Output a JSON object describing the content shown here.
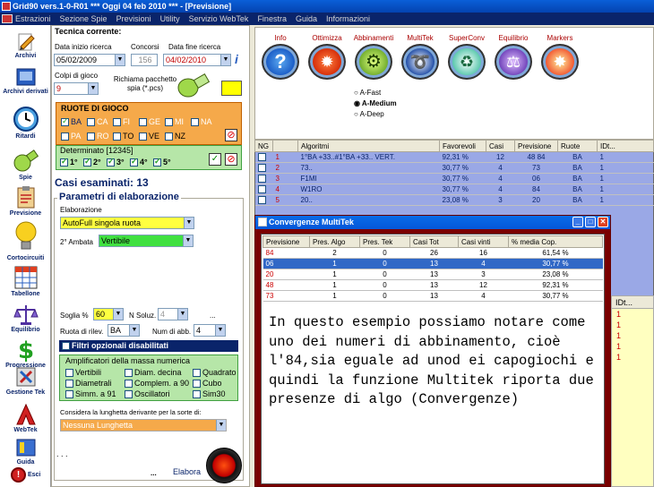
{
  "window": {
    "title": "Grid90 vers.1-0-R01   ***  Oggi 04 feb 2010   ***  - [Previsione]"
  },
  "menu": [
    "Estrazioni",
    "Sezione Spie",
    "Previsioni",
    "Utility",
    "Servizio WebTek",
    "Finestra",
    "Guida",
    "Informazioni"
  ],
  "sidebar": {
    "items": [
      "Archivi",
      "Archivi derivati",
      "Ritardi",
      "Spie",
      "Previsione",
      "Cortocircuiti",
      "Tabellone",
      "Equilibrio",
      "Progressione",
      "Gestione Tek",
      "WebTek",
      "Guida",
      "Esci"
    ]
  },
  "tecnica": {
    "header": "Tecnica corrente:",
    "data_inizio_label": "Data inizio ricerca",
    "data_inizio": "05/02/2009",
    "concorsi_label": "Concorsi",
    "concorsi": "156",
    "data_fine_label": "Data fine ricerca",
    "data_fine": "04/02/2010",
    "colpi_label": "Colpi di gioco",
    "colpi": "9",
    "pacchetto_label": "Richiama pacchetto spia (*.pcs)"
  },
  "ruote": {
    "header": "RUOTE DI GIOCO",
    "row1": [
      {
        "n": "BA",
        "on": true
      },
      {
        "n": "CA",
        "on": false
      },
      {
        "n": "FI",
        "on": false
      },
      {
        "n": "GE",
        "on": false
      },
      {
        "n": "MI",
        "on": false
      },
      {
        "n": "NA",
        "on": false
      }
    ],
    "row2": [
      {
        "n": "PA",
        "on": false
      },
      {
        "n": "RO",
        "on": false
      },
      {
        "n": "TO",
        "on": false
      },
      {
        "n": "VE",
        "on": false
      },
      {
        "n": "NZ",
        "on": false
      }
    ]
  },
  "determinato": {
    "label": "Determinato [12345]",
    "items": [
      {
        "n": "1°",
        "on": true
      },
      {
        "n": "2°",
        "on": true
      },
      {
        "n": "3°",
        "on": true
      },
      {
        "n": "4°",
        "on": true
      },
      {
        "n": "5°",
        "on": true
      }
    ]
  },
  "casi": "Casi esaminati: 13",
  "parametri": {
    "header": "Parametri di elaborazione",
    "elab_label": "Elaborazione",
    "elab_value": "AutoFull singola ruota",
    "ambata_label": "2° Ambata",
    "ambata_value": "Vertibile",
    "soglia_label": "Soglia %",
    "soglia_value": "60",
    "nsoluz_label": "N Soluz.",
    "nsoluz_value": "4",
    "ellipsis": "...",
    "ruota_label": "Ruota di rilev.",
    "ruota_value": "BA",
    "abb_label": "Num di abb.",
    "abb_value": "4",
    "filtri_label": "Filtri opzionali disabilitati",
    "ampl_label": "Amplificatori della massa numerica",
    "ampl": [
      [
        "Vertibili",
        "Diam. decina",
        "Quadrato"
      ],
      [
        "Diametrali",
        "Complem. a 90",
        "Cubo"
      ],
      [
        "Simm. a 91",
        "Oscillatori",
        "Sim30"
      ]
    ],
    "lunghetta_label": "Considera la lunghetta derivante per la sorte di:",
    "lunghetta_value": "Nessuna Lunghetta",
    "dots": ". . .",
    "elabora_dots": "...",
    "elabora_label": "Elabora"
  },
  "metodi": {
    "buttons": [
      "Info",
      "Ottimizza",
      "Abbinamenti",
      "MultiTek",
      "SuperConv",
      "Equilibrio",
      "Markers"
    ],
    "radios": [
      {
        "label": "A-Fast",
        "on": false
      },
      {
        "label": "A-Medium",
        "on": true
      },
      {
        "label": "A-Deep",
        "on": false
      }
    ]
  },
  "results": {
    "headers": [
      "NG",
      "",
      "Algoritmi",
      "Favorevoli",
      "Casi",
      "Previsione",
      "Ruote",
      "IDt..."
    ],
    "rows": [
      [
        "1",
        "1°BA +33..#1°BA +33.. VERT.",
        "92,31 %",
        "12",
        "48 84",
        "BA",
        "1"
      ],
      [
        "2",
        "73..",
        "30,77 %",
        "4",
        "73",
        "BA",
        "1"
      ],
      [
        "3",
        "F1MI",
        "30,77 %",
        "4",
        "06",
        "BA",
        "1"
      ],
      [
        "4",
        "W1RO",
        "30,77 %",
        "4",
        "84",
        "BA",
        "1"
      ],
      [
        "5",
        "20..",
        "23,08 %",
        "3",
        "20",
        "BA",
        "1"
      ]
    ],
    "side_header": "IDt...",
    "side_values": [
      "1",
      "1",
      "1",
      "1",
      "1"
    ]
  },
  "popup": {
    "title": "Convergenze MultiTek",
    "headers": [
      "Previsione",
      "Pres. Algo",
      "Pres. Tek",
      "Casi Tot",
      "Casi vinti",
      "% media Cop."
    ],
    "rows": [
      [
        "84",
        "2",
        "0",
        "26",
        "16",
        "61,54 %"
      ],
      [
        "06",
        "1",
        "0",
        "13",
        "4",
        "30,77 %"
      ],
      [
        "20",
        "1",
        "0",
        "13",
        "3",
        "23,08 %"
      ],
      [
        "48",
        "1",
        "0",
        "13",
        "12",
        "92,31 %"
      ],
      [
        "73",
        "1",
        "0",
        "13",
        "4",
        "30,77 %"
      ]
    ],
    "note": "In questo esempio possiamo notare come uno dei numeri di abbinamento, cioè l'84,sia eguale ad unod ei capogiochi e quindi la funzione Multitek riporta due presenze di algo (Convergenze)"
  },
  "colors": {
    "accent": "#0a246a",
    "popup_bg": "#7a0000",
    "ruote_bg": "#f5a94a",
    "determ_bg": "#b6e6a8",
    "grid_bg": "#9aa8e6",
    "selected": "#3168c6"
  }
}
